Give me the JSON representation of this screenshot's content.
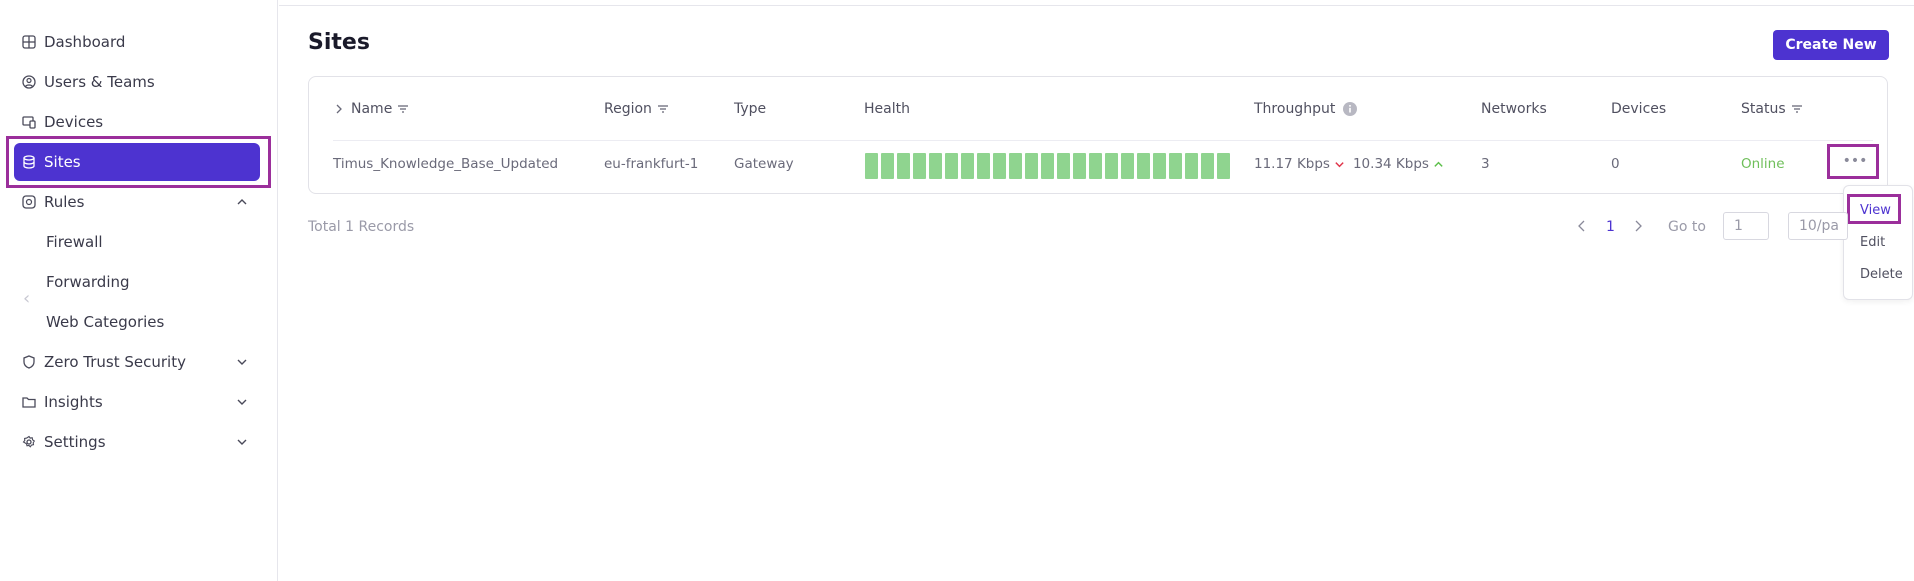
{
  "sidebar": {
    "items": [
      {
        "label": "Dashboard",
        "icon": "dashboard-icon"
      },
      {
        "label": "Users & Teams",
        "icon": "user-icon"
      },
      {
        "label": "Devices",
        "icon": "devices-icon"
      },
      {
        "label": "Sites",
        "icon": "database-icon",
        "active": true
      },
      {
        "label": "Rules",
        "icon": "rules-icon",
        "expanded": true
      },
      {
        "label": "Zero Trust Security",
        "icon": "shield-icon"
      },
      {
        "label": "Insights",
        "icon": "folder-icon"
      },
      {
        "label": "Settings",
        "icon": "gear-icon"
      }
    ],
    "rules_children": [
      "Firewall",
      "Forwarding",
      "Web Categories"
    ],
    "collapse_glyph": "‹"
  },
  "header": {
    "title": "Sites",
    "create_label": "Create New"
  },
  "table": {
    "columns": [
      "Name",
      "Region",
      "Type",
      "Health",
      "Throughput",
      "Networks",
      "Devices",
      "Status"
    ],
    "rows": [
      {
        "name": "Timus_Knowledge_Base_Updated",
        "region": "eu-frankfurt-1",
        "type": "Gateway",
        "health_segments": 23,
        "throughput_down": "11.17 Kbps",
        "throughput_up": "10.34 Kbps",
        "networks": "3",
        "devices": "0",
        "status": "Online"
      }
    ],
    "more_glyph": "•••"
  },
  "row_menu": {
    "items": [
      "View",
      "Edit",
      "Delete"
    ]
  },
  "footer": {
    "total": "Total 1  Records",
    "current_page": "1",
    "goto_label": "Go to",
    "goto_value": "1",
    "page_size": "10/pa"
  },
  "colors": {
    "accent": "#4d33d0",
    "highlight": "#9b2f9b",
    "health": "#8fd48f",
    "online": "#6fbf5a",
    "down": "#e0344a",
    "up": "#5cbf4a"
  }
}
